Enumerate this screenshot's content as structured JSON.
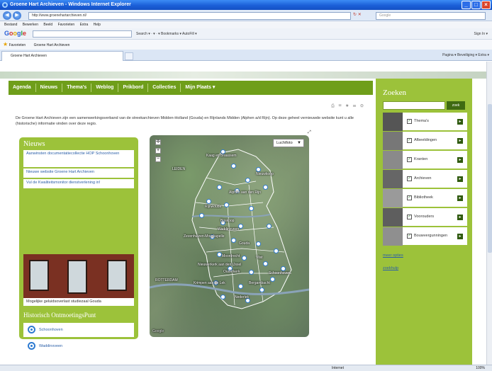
{
  "window": {
    "title": "Groene Hart Archieven - Windows Internet Explorer",
    "address": "http://www.groenehartarchieven.nl/",
    "search_placeholder": "Google",
    "menu": [
      "Bestand",
      "Bewerken",
      "Beeld",
      "Favorieten",
      "Extra",
      "Help"
    ],
    "google_tools": "Search ▾  ·  ▾  ·  ▾  Bookmarks ▾   AutoFill ▾",
    "google_signin": "Sign In ▾",
    "favorites_label": "Favorieten",
    "favorites_item": "Groene Hart Archieven",
    "tab_title": "Groene Hart Archieven",
    "command_bar": "Pagina ▾  Beveiliging ▾  Extra ▾",
    "status_zone": "Internet",
    "status_zoom": "100%"
  },
  "nav": [
    "Agenda",
    "Nieuws",
    "Thema's",
    "Weblog",
    "Prikbord",
    "Collecties",
    "Mijn Plaats ▾"
  ],
  "intro_text": "De Groene Hart Archieven zijn een samenwerkingsverband van de streekarchieven Midden-Holland (Gouda) en Rijnlands Midden (Alphen a/d Rijn). Op deze geheel vernieuwde website kunt u alle (historische) informatie vinden over deze regio.",
  "news": {
    "title": "Nieuws",
    "items": [
      "Aanwinsten documentatiecollectie HOP Schoonhoven",
      "Nieuwe website Groene Hart Archieven",
      "Vul de Kwaliteitsmonitor dienstverlening in!"
    ],
    "caption": "Mogelijke geluidsoverlast studiezaal Gouda"
  },
  "hop": {
    "title": "Historisch OntmoetingsPunt",
    "items": [
      "Schoonhoven",
      "Waddinxveen"
    ]
  },
  "map": {
    "type_label": "Luchtfoto",
    "labels": [
      {
        "text": "LEIDEN"
      },
      {
        "text": "Kaag en Braassem"
      },
      {
        "text": "Nieuwkoop"
      },
      {
        "text": "Alphen aan den Rijn"
      },
      {
        "text": "Rijnwoude"
      },
      {
        "text": "Boskoop"
      },
      {
        "text": "Waddinxveen"
      },
      {
        "text": "Zevenhuizen-Moerkapelle"
      },
      {
        "text": "Gouda"
      },
      {
        "text": "Moordrecht"
      },
      {
        "text": "Vlist"
      },
      {
        "text": "Schoonhoven"
      },
      {
        "text": "Nieuwerkerk aan den IJssel"
      },
      {
        "text": "Ouderkerk"
      },
      {
        "text": "Bergambacht"
      },
      {
        "text": "ROTTERDAM"
      },
      {
        "text": "Krimpen aan de Lek"
      },
      {
        "text": "Nederlek"
      }
    ]
  },
  "search": {
    "title": "Zoeken",
    "button": "zoek",
    "themes": [
      "Thema's",
      "Afbeeldingen",
      "Kranten",
      "Archieven",
      "Bibliotheek",
      "Voorouders",
      "Bouwvergunningen"
    ],
    "more_options": "meer opties",
    "help": "zoekhulp"
  }
}
